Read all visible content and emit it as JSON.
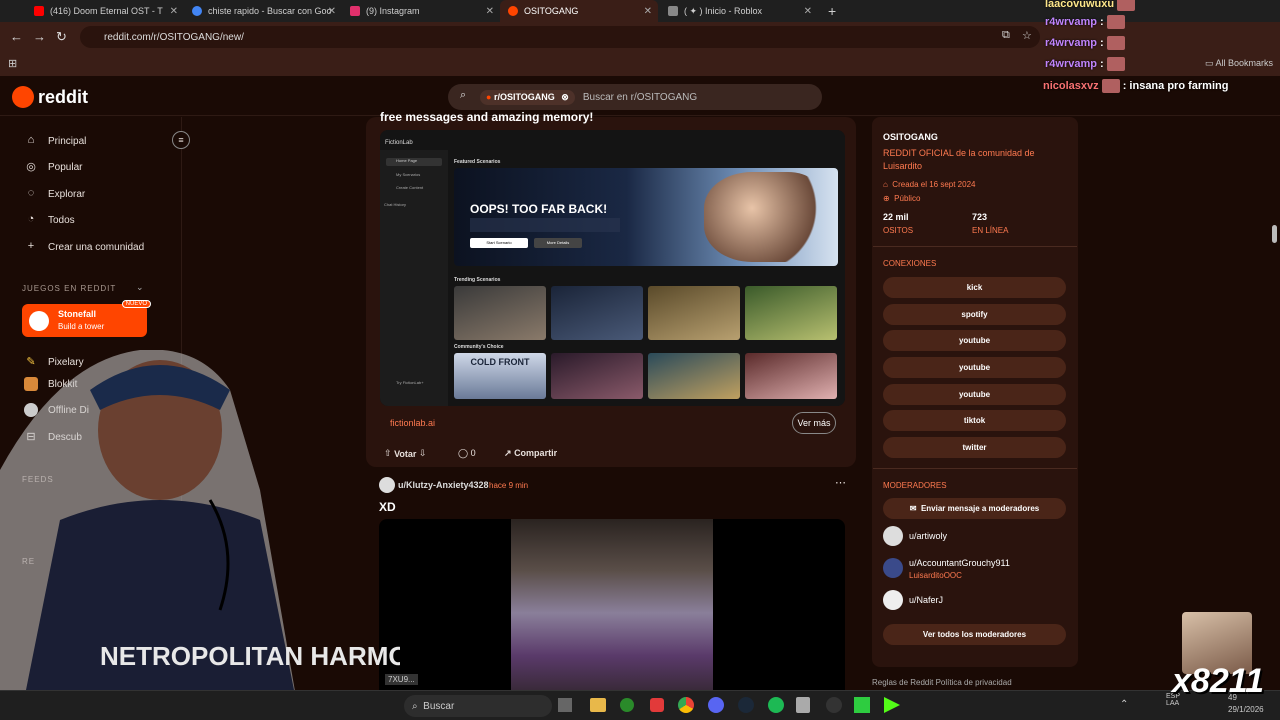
{
  "tabs": [
    {
      "title": "(416) Doom Eternal OST - T",
      "color": "#ff0000"
    },
    {
      "title": "chiste rapido - Buscar con Goo",
      "color": "#4285f4"
    },
    {
      "title": "(9) Instagram",
      "color": "#e1306c"
    },
    {
      "title": "OSITOGANG",
      "color": "#ff4500"
    },
    {
      "title": "( ✦ ) Inicio - Roblox",
      "color": "#6a6a6a"
    }
  ],
  "url": "reddit.com/r/OSITOGANG/new/",
  "bookmarks_label": "All Bookmarks",
  "header": {
    "logo_text": "reddit",
    "search_chip": "r/OSITOGANG",
    "search_placeholder": "Buscar en r/OSITOGANG"
  },
  "sidebar": {
    "items": [
      {
        "label": "Principal",
        "icon": "home-icon"
      },
      {
        "label": "Popular",
        "icon": "popular-icon"
      },
      {
        "label": "Explorar",
        "icon": "explore-icon"
      },
      {
        "label": "Todos",
        "icon": "all-icon"
      },
      {
        "label": "Crear una comunidad",
        "icon": "plus-icon"
      }
    ],
    "games_section": "JUEGOS EN REDDIT",
    "stonefall": {
      "title": "Stonefall",
      "subtitle": "Build a tower",
      "badge": "NUEVO"
    },
    "games": [
      "Pixelary",
      "Blokkit",
      "Offline Di",
      "Descub"
    ],
    "feeds_section": "FEEDS",
    "re_section": "RE"
  },
  "post1": {
    "title": "free messages and amazing memory!",
    "link": "fictionlab.ai",
    "ver_mas": "Ver más",
    "vote": "Votar",
    "comments": "0",
    "share": "Compartir",
    "image": {
      "brand": "FictionLab",
      "featured": "Featured Scenarios",
      "hero_title": "OOPS! TOO FAR BACK!",
      "btn1": "Start Scenario",
      "btn2": "More Details",
      "trending": "Trending Scenarios",
      "community": "Community's Choice",
      "side_items": [
        "Home Page",
        "My Scenarios",
        "Create Content",
        "Chat History"
      ],
      "cold_front": "COLD FRONT",
      "footer": "Try FictionLab+"
    }
  },
  "post2": {
    "author": "u/Klutzy-Anxiety4328",
    "time": "hace 9 min",
    "title": "XD",
    "video_label": "7XU9..."
  },
  "community": {
    "name": "OSITOGANG",
    "description": "REDDIT OFICIAL de la comunidad de Luisardito",
    "created": "Creada el 16 sept 2024",
    "visibility": "Público",
    "members": "22 mil",
    "members_label": "OSITOS",
    "online": "723",
    "online_label": "EN LÍNEA",
    "connections_title": "CONEXIONES",
    "connections": [
      "kick",
      "spotify",
      "youtube",
      "youtube",
      "youtube",
      "tiktok",
      "twitter"
    ],
    "mods_title": "MODERADORES",
    "message_mods": "Enviar mensaje a moderadores",
    "mods": [
      {
        "name": "u/artiwoly",
        "flair": ""
      },
      {
        "name": "u/AccountantGrouchy911",
        "flair": "LuisarditoOOC"
      },
      {
        "name": "u/NaferJ",
        "flair": ""
      }
    ],
    "view_all_mods": "Ver todos los moderadores",
    "footer": "Reglas de Reddit   Política de privacidad"
  },
  "chat": [
    {
      "name": "laacovuwuxu",
      "text": ""
    },
    {
      "name": "r4wrvamp",
      "text": ":"
    },
    {
      "name": "r4wrvamp",
      "text": ":"
    },
    {
      "name": "r4wrvamp",
      "text": ":"
    },
    {
      "name": "nicolasxvz",
      "text": ": insana pro farming"
    }
  ],
  "taskbar": {
    "search": "Buscar",
    "lang": "ESP LAA",
    "time": "49",
    "date": "29/1/2026"
  },
  "overlay_text": "x8211",
  "shirt_text": "NETROPOLITAN HARMONY"
}
